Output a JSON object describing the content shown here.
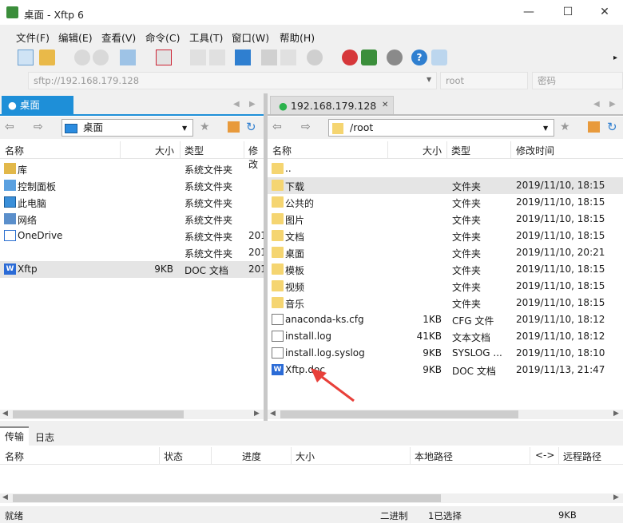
{
  "window": {
    "title": "桌面 - Xftp 6",
    "min": "—",
    "max": "☐",
    "close": "✕"
  },
  "menu": [
    "文件(F)",
    "编辑(E)",
    "查看(V)",
    "命令(C)",
    "工具(T)",
    "窗口(W)",
    "帮助(H)"
  ],
  "address": {
    "url_placeholder": "sftp://192.168.179.128",
    "user_placeholder": "root",
    "password_placeholder": "密码"
  },
  "left": {
    "tab": "桌面",
    "path": "桌面",
    "columns": [
      "名称",
      "大小",
      "类型",
      "修改"
    ],
    "rows": [
      {
        "name": "库",
        "size": "",
        "type": "系统文件夹",
        "mod": "",
        "icon": "library-icon"
      },
      {
        "name": "控制面板",
        "size": "",
        "type": "系统文件夹",
        "mod": "",
        "icon": "control-panel-icon"
      },
      {
        "name": "此电脑",
        "size": "",
        "type": "系统文件夹",
        "mod": "",
        "icon": "computer-icon"
      },
      {
        "name": "网络",
        "size": "",
        "type": "系统文件夹",
        "mod": "",
        "icon": "network-icon"
      },
      {
        "name": "OneDrive",
        "size": "",
        "type": "系统文件夹",
        "mod": "201",
        "icon": "onedrive-icon"
      },
      {
        "name": "",
        "size": "",
        "type": "系统文件夹",
        "mod": "201",
        "icon": ""
      },
      {
        "name": "Xftp",
        "size": "9KB",
        "type": "DOC 文档",
        "mod": "201",
        "icon": "word-doc-icon"
      }
    ]
  },
  "right": {
    "tab": "192.168.179.128",
    "tab_close": "✕",
    "path": "/root",
    "columns": [
      "名称",
      "大小",
      "类型",
      "修改时间"
    ],
    "rows": [
      {
        "name": "..",
        "size": "",
        "type": "",
        "mod": "",
        "icon": "folder"
      },
      {
        "name": "下载",
        "size": "",
        "type": "文件夹",
        "mod": "2019/11/10, 18:15",
        "icon": "folder"
      },
      {
        "name": "公共的",
        "size": "",
        "type": "文件夹",
        "mod": "2019/11/10, 18:15",
        "icon": "folder"
      },
      {
        "name": "图片",
        "size": "",
        "type": "文件夹",
        "mod": "2019/11/10, 18:15",
        "icon": "folder"
      },
      {
        "name": "文档",
        "size": "",
        "type": "文件夹",
        "mod": "2019/11/10, 18:15",
        "icon": "folder"
      },
      {
        "name": "桌面",
        "size": "",
        "type": "文件夹",
        "mod": "2019/11/10, 20:21",
        "icon": "folder"
      },
      {
        "name": "模板",
        "size": "",
        "type": "文件夹",
        "mod": "2019/11/10, 18:15",
        "icon": "folder"
      },
      {
        "name": "视频",
        "size": "",
        "type": "文件夹",
        "mod": "2019/11/10, 18:15",
        "icon": "folder"
      },
      {
        "name": "音乐",
        "size": "",
        "type": "文件夹",
        "mod": "2019/11/10, 18:15",
        "icon": "folder"
      },
      {
        "name": "anaconda-ks.cfg",
        "size": "1KB",
        "type": "CFG 文件",
        "mod": "2019/11/10, 18:12",
        "icon": "file"
      },
      {
        "name": "install.log",
        "size": "41KB",
        "type": "文本文档",
        "mod": "2019/11/10, 18:12",
        "icon": "file"
      },
      {
        "name": "install.log.syslog",
        "size": "9KB",
        "type": "SYSLOG ...",
        "mod": "2019/11/10, 18:10",
        "icon": "file"
      },
      {
        "name": "Xftp.doc",
        "size": "9KB",
        "type": "DOC 文档",
        "mod": "2019/11/13, 21:47",
        "icon": "doc"
      }
    ]
  },
  "transfer": {
    "tabs": [
      "传输",
      "日志"
    ],
    "columns": [
      "名称",
      "状态",
      "进度",
      "大小",
      "本地路径",
      "<->",
      "远程路径"
    ]
  },
  "status": {
    "left": "就绪",
    "mode": "二进制",
    "selection": "1已选择",
    "size": "9KB"
  },
  "colors": {
    "accent": "#1e8fd8",
    "selected_row": "#e5e5e5",
    "folder": "#f5d571",
    "arrow": "#e8403a"
  }
}
